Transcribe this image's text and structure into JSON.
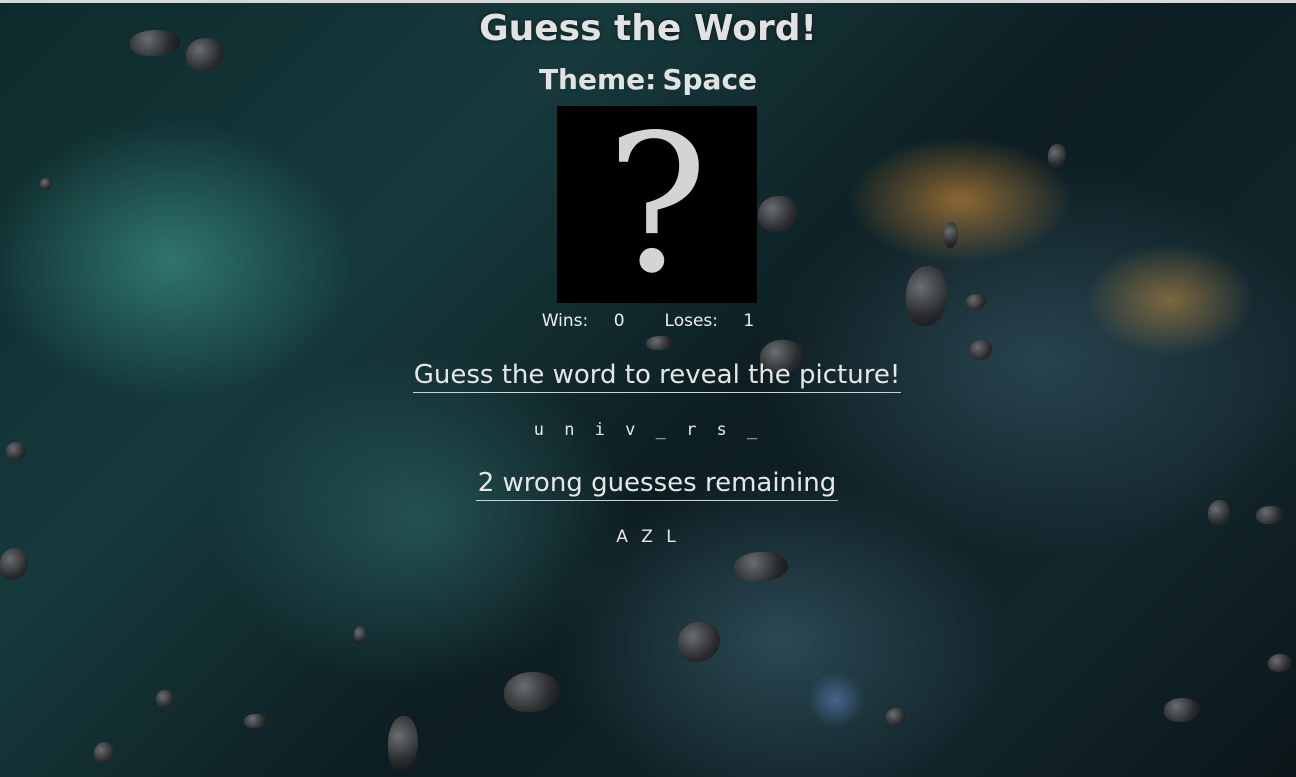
{
  "game": {
    "title": "Guess the Word!",
    "theme_label": "Theme:",
    "theme_value": "Space",
    "picture_placeholder": "?",
    "wins_label": "Wins:",
    "wins": "0",
    "loses_label": "Loses:",
    "loses": "1",
    "prompt": "Guess the word to reveal the picture!",
    "word_display": "u n i v _ r s _",
    "remaining": "2 wrong guesses remaining",
    "wrong_letters": "A Z L"
  },
  "colors": {
    "text": "#e6e6e6",
    "picture_bg": "#000000",
    "accent_rule": "#d8d8d8"
  }
}
